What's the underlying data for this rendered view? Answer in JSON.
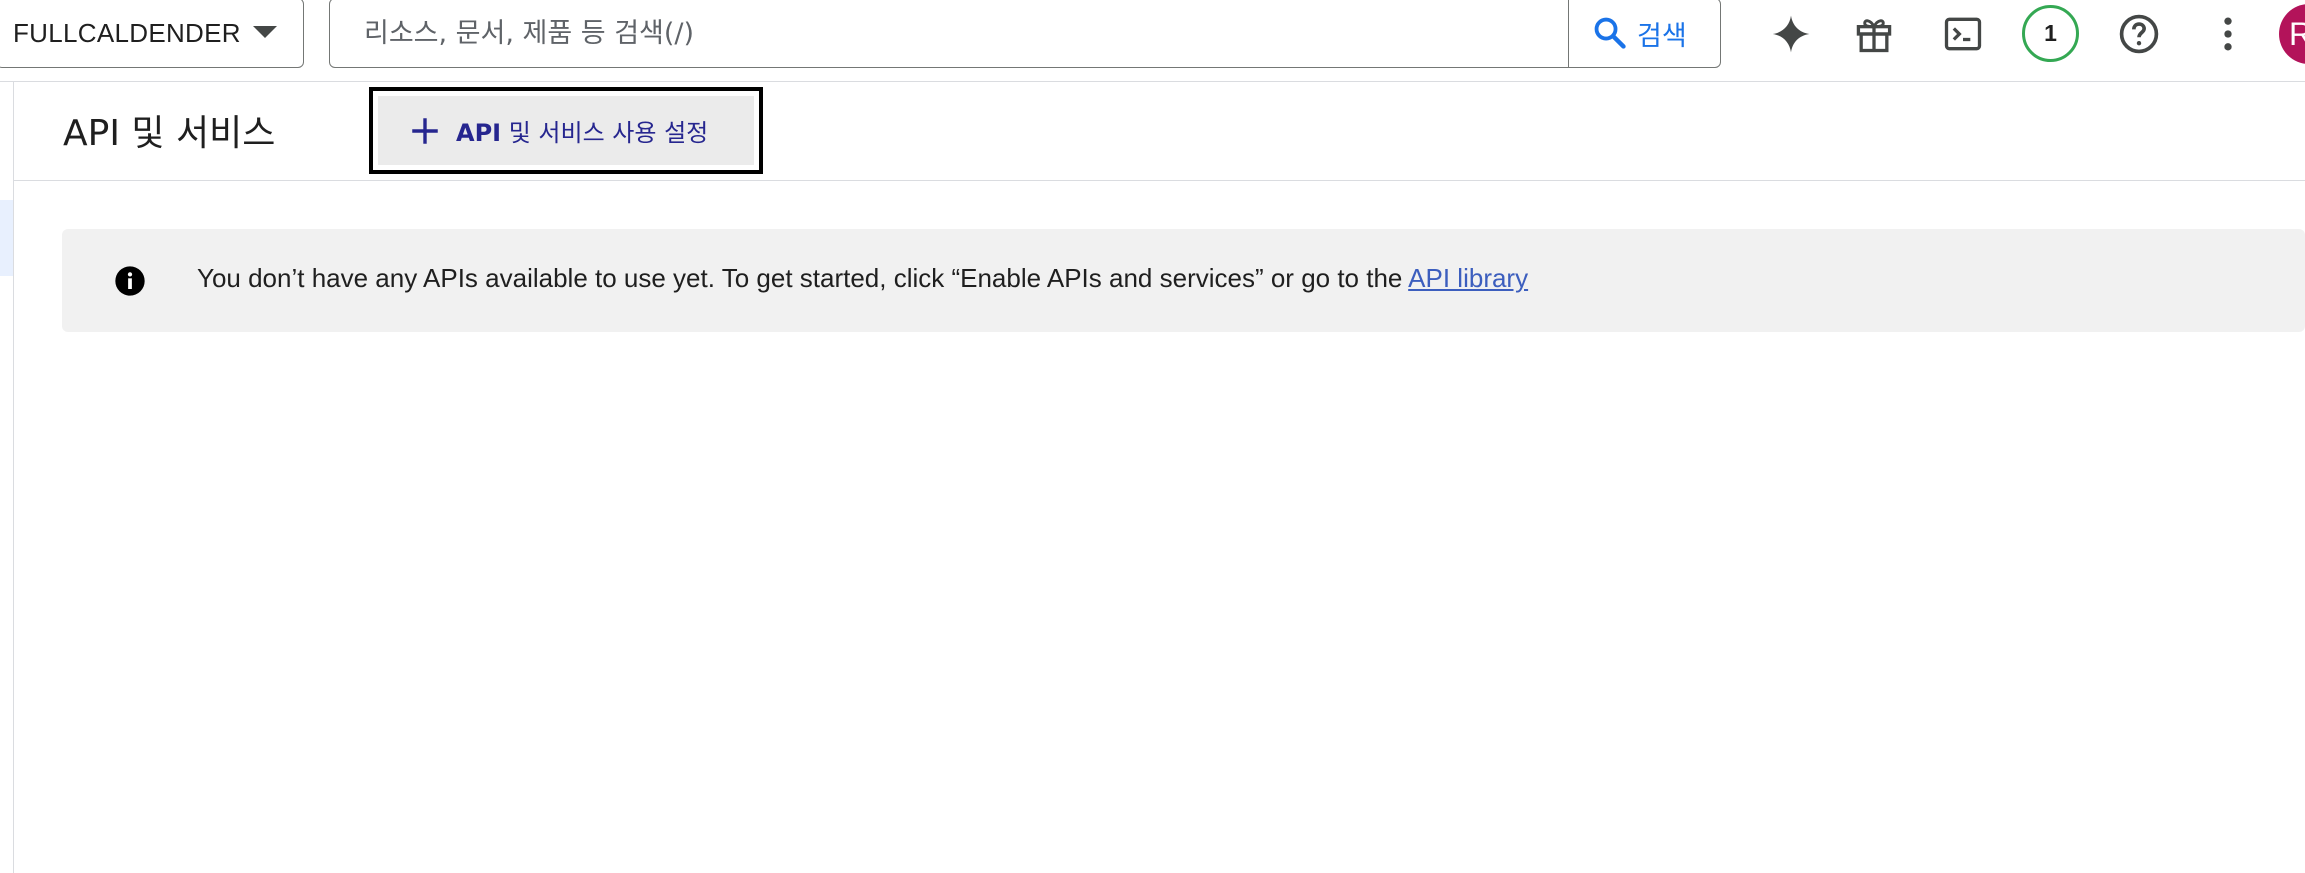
{
  "topbar": {
    "project_name": "FULLCALDENDER",
    "search": {
      "placeholder": "리소스, 문서, 제품 등 검색(/)",
      "button_label": "검색"
    },
    "notification_count": "1",
    "avatar_initial": "R"
  },
  "page": {
    "title": "API 및 서비스",
    "enable_button": {
      "label_api": "API",
      "label_rest": " 및 서비스 사용 설정",
      "icon": "plus-icon"
    }
  },
  "banner": {
    "icon": "info-icon",
    "message": "You don’t have any APIs available to use yet. To get started, click “Enable APIs and services” or go to the ",
    "link_text": "API library"
  },
  "colors": {
    "accent_blue": "#1a73e8",
    "notification_ring": "#34a853",
    "avatar_bg": "#b3135a",
    "link": "#3c5ebe",
    "banner_bg": "#f1f1f1"
  }
}
